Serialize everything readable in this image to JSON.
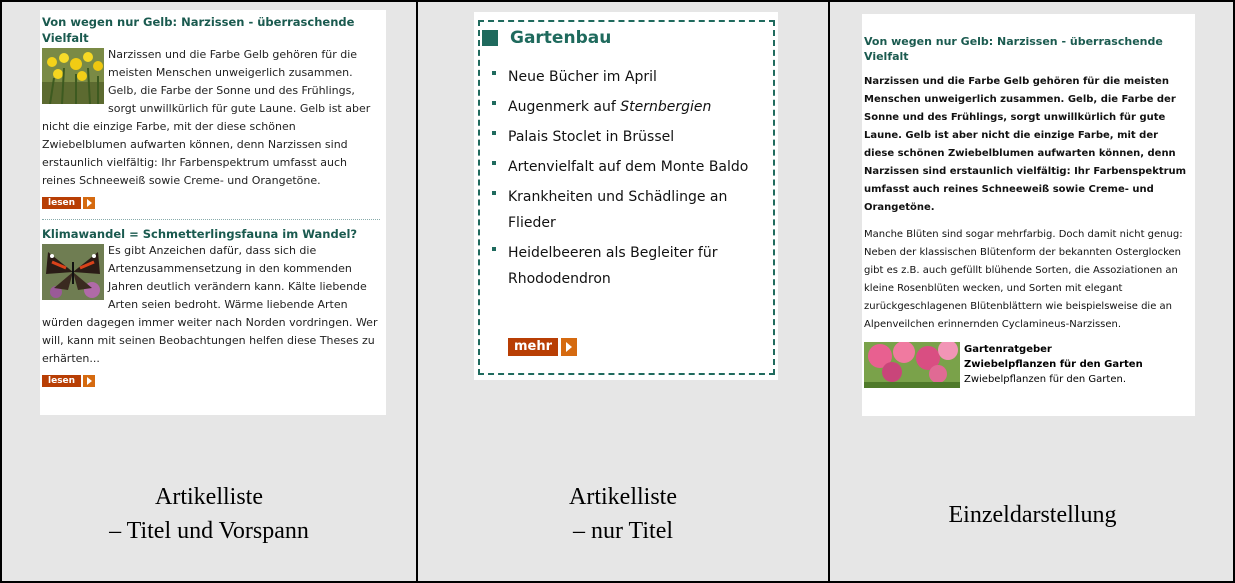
{
  "panel1": {
    "article1": {
      "title": "Von wegen nur Gelb: Narzissen - überraschende Vielfalt",
      "text": "Narzissen und die Farbe Gelb gehören für die meisten Menschen unweigerlich zusammen. Gelb, die Farbe der Sonne und des Frühlings, sorgt unwillkürlich für gute Laune. Gelb ist aber nicht die einzige Farbe, mit der diese schönen Zwiebelblumen aufwarten können, denn Narzissen sind erstaunlich vielfältig: Ihr Farbenspektrum umfasst auch reines Schneeweiß sowie Creme- und Orangetöne.",
      "more_label": "lesen"
    },
    "article2": {
      "title": "Klimawandel = Schmetterlingsfauna im Wandel?",
      "text": "Es gibt Anzeichen dafür, dass sich die Artenzusammensetzung in den kommenden Jahren deutlich verändern kann. Kälte liebende Arten seien bedroht. Wärme liebende Arten würden dagegen immer weiter nach Norden vordringen. Wer will, kann mit seinen Beobachtungen helfen diese Theses zu erhärten...",
      "more_label": "lesen"
    },
    "caption_line1": "Artikelliste",
    "caption_line2": "– Titel und Vorspann"
  },
  "panel2": {
    "heading": "Gartenbau",
    "items": [
      {
        "pre": "Neue Bücher im April",
        "em": "",
        "post": ""
      },
      {
        "pre": "Augenmerk auf ",
        "em": "Sternbergien",
        "post": ""
      },
      {
        "pre": "Palais Stoclet in Brüssel",
        "em": "",
        "post": ""
      },
      {
        "pre": "Artenvielfalt auf dem Monte Baldo",
        "em": "",
        "post": ""
      },
      {
        "pre": "Krankheiten und Schädlinge an Flieder",
        "em": "",
        "post": ""
      },
      {
        "pre": "Heidelbeeren als Begleiter für Rhododendron",
        "em": "",
        "post": ""
      }
    ],
    "more_label": "mehr",
    "caption_line1": "Artikelliste",
    "caption_line2": "– nur Titel"
  },
  "panel3": {
    "title": "Von wegen nur Gelb: Narzissen - überraschende Vielfalt",
    "lead": "Narzissen und die Farbe Gelb gehören für die meisten Menschen unweigerlich zusammen. Gelb, die Farbe der Sonne und des Frühlings, sorgt unwillkürlich für gute Laune. Gelb ist aber nicht die einzige Farbe, mit der diese schönen Zwiebelblumen aufwarten können, denn Narzissen sind erstaunlich vielfältig: Ihr Farbenspektrum umfasst auch reines Schneeweiß sowie Creme- und Orangetöne.",
    "body": "Manche Blüten sind sogar mehrfarbig. Doch damit nicht genug: Neben der klassischen Blütenform der bekannten Osterglocken gibt es z.B. auch gefüllt blühende Sorten, die Assoziationen an kleine Rosenblüten wecken, und Sorten mit elegant zurückgeschlagenen Blütenblättern wie beispielsweise die an Alpenveilchen erinnernden Cyclamineus-Narzissen.",
    "book_line1": "Gartenratgeber",
    "book_line2": "Zwiebelpflanzen für den Garten",
    "book_line3": "Zwiebelpflanzen für den Garten.",
    "caption": "Einzeldarstellung"
  },
  "colors": {
    "accent_green": "#1f6a5d",
    "button_red": "#b83e04",
    "button_orange": "#d56a10",
    "background_gray": "#e6e6e6"
  }
}
